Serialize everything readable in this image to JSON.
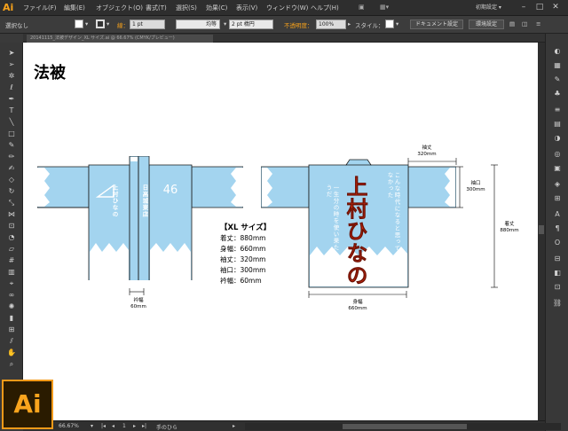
{
  "app": {
    "logo": "Ai",
    "workspace": "初期設定"
  },
  "menus": [
    "ファイル(F)",
    "編集(E)",
    "オブジェクト(O)",
    "書式(T)",
    "選択(S)",
    "効果(C)",
    "表示(V)",
    "ウィンドウ(W)",
    "ヘルプ(H)"
  ],
  "control": {
    "selection": "選択なし",
    "stroke_label": "線：",
    "stroke_value": "1 pt",
    "profile": "均等",
    "brush": "2 pt 楕円",
    "opacity_label": "不透明度：",
    "opacity_value": "100%",
    "style_label": "スタイル：",
    "doc_settings": "ドキュメント設定",
    "prefs": "環境設定"
  },
  "tab": {
    "title": "20141115_法被デザイン_XL サイズ.ai @ 66.67% (CMYK/プレビュー)"
  },
  "status": {
    "zoom": "66.67%",
    "page": "1",
    "tool": "手のひら"
  },
  "document": {
    "title": "法被",
    "front": {
      "number": "46",
      "right_strip": "日高城東店",
      "left_strip": "上村ひなの"
    },
    "back": {
      "big_name": "上村ひなの",
      "small_right": "こんな時代になると思っていなかった",
      "small_left": "一生分の時を使い果たしたようだ"
    },
    "dims": {
      "sode_label": "袖丈",
      "sode_value": "320mm",
      "sodeguchi_label": "袖口",
      "sodeguchi_value": "300mm",
      "kitake_label": "着丈",
      "kitake_value": "880mm",
      "mihaba_label": "身幅",
      "mihaba_value": "660mm",
      "eri_label": "衿幅",
      "eri_value": "60mm"
    },
    "specs": {
      "title": "【XL サイズ】",
      "rows": [
        "着丈：880mm",
        "身幅：660mm",
        "袖丈：320mm",
        "袖口：300mm",
        "衿幅：60mm"
      ]
    }
  },
  "colors": {
    "garment": "#a3d4ef",
    "outline": "#1a1a1a",
    "name_red": "#d62a10",
    "accent": "#f7a21b"
  }
}
